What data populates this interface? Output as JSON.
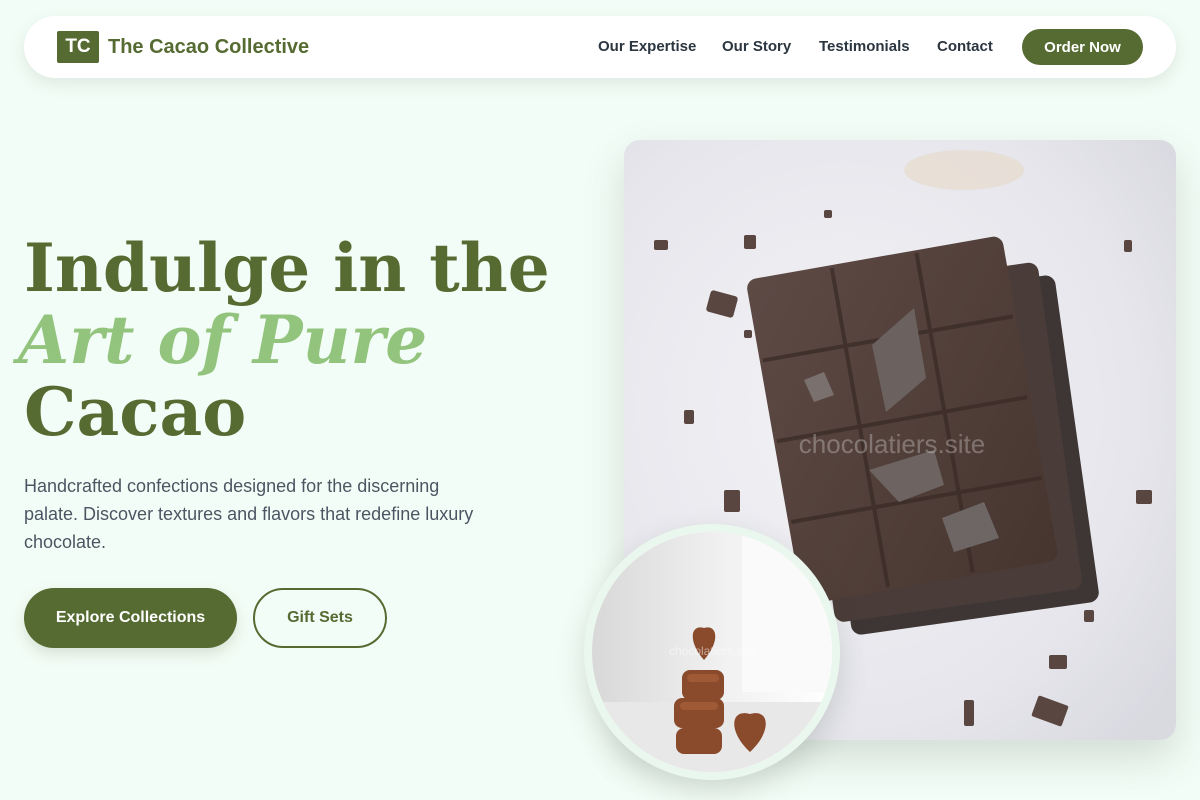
{
  "brand": {
    "badge": "TC",
    "name": "The Cacao Collective"
  },
  "nav": {
    "links": [
      "Our Expertise",
      "Our Story",
      "Testimonials",
      "Contact"
    ],
    "cta": "Order Now"
  },
  "hero": {
    "title_line1": "Indulge in the",
    "title_line2": "Art of Pure",
    "title_line3": "Cacao",
    "description": "Handcrafted confections designed for the discerning palate. Discover textures and flavors that redefine luxury chocolate.",
    "primary_button": "Explore Collections",
    "secondary_button": "Gift Sets"
  },
  "images": {
    "main_watermark": "chocolatiers.site",
    "circle_watermark": "chocolatiers.site"
  },
  "colors": {
    "brand": "#566b32",
    "accent": "#93c47d",
    "background": "#f3fdf7"
  }
}
